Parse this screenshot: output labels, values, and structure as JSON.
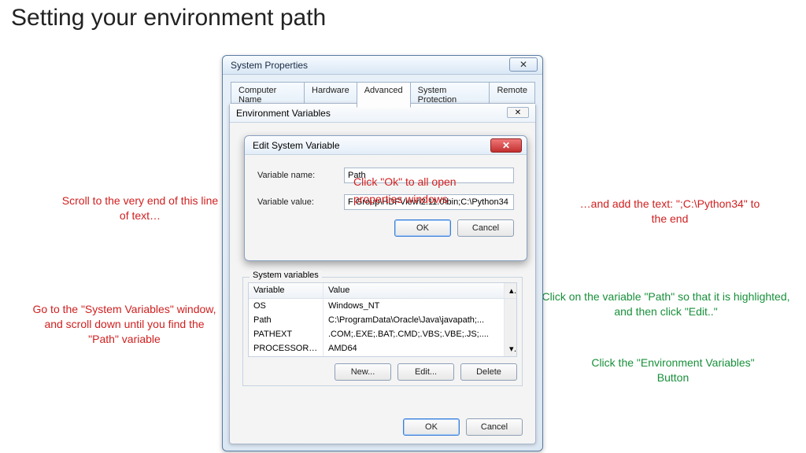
{
  "slide_title": "Setting your environment path",
  "annotations": {
    "scroll_end": "Scroll to the very end of this line of text…",
    "goto_sysvars": "Go to the \"System Variables\" window, and scroll down until you find the \"Path\" variable",
    "add_text": "…and add the text: \";C:\\Python34\" to the end",
    "click_path": "Click on the variable \"Path\" so that it is highlighted, and then click \"Edit..\"",
    "click_envvars": "Click the \"Environment Variables\" Button",
    "click_ok_line1": "Click \"Ok\" to all open",
    "click_ok_line2": "properties windows"
  },
  "sysprops": {
    "title": "System Properties",
    "close_glyph": "✕",
    "tabs": [
      "Computer Name",
      "Hardware",
      "Advanced",
      "System Protection",
      "Remote"
    ],
    "active_tab_index": 2
  },
  "envdlg": {
    "title": "Environment Variables",
    "close_glyph": "✕",
    "sysvars_label": "System variables",
    "headers": {
      "variable": "Variable",
      "value": "Value"
    },
    "rows": [
      {
        "var": "OS",
        "val": "Windows_NT"
      },
      {
        "var": "Path",
        "val": "C:\\ProgramData\\Oracle\\Java\\javapath;..."
      },
      {
        "var": "PATHEXT",
        "val": ".COM;.EXE;.BAT;.CMD;.VBS;.VBE;.JS;...."
      },
      {
        "var": "PROCESSOR_A...",
        "val": "AMD64"
      }
    ],
    "selected_row_index": 1,
    "buttons": {
      "new": "New...",
      "edit": "Edit...",
      "delete": "Delete",
      "ok": "OK",
      "cancel": "Cancel"
    }
  },
  "editdlg": {
    "title": "Edit System Variable",
    "close_glyph": "✕",
    "name_label": "Variable name:",
    "name_value": "Path",
    "value_label": "Variable value:",
    "value_value": "F Group\\HDFView\\2.11.0\\bin;C:\\Python34",
    "ok": "OK",
    "cancel": "Cancel"
  }
}
